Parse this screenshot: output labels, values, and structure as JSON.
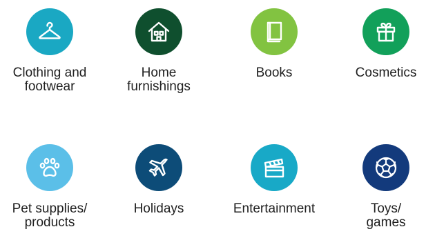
{
  "categories": [
    {
      "icon": "hanger-icon",
      "color": "#1aa8c3",
      "label_line1": "Clothing and",
      "label_line2": "footwear"
    },
    {
      "icon": "house-icon",
      "color": "#0f4f2e",
      "label_line1": "Home",
      "label_line2": "furnishings"
    },
    {
      "icon": "book-icon",
      "color": "#82c341",
      "label_line1": "Books",
      "label_line2": ""
    },
    {
      "icon": "gift-icon",
      "color": "#12a05a",
      "label_line1": "Cosmetics",
      "label_line2": ""
    },
    {
      "icon": "paw-icon",
      "color": "#5bbfe8",
      "label_line1": "Pet supplies/",
      "label_line2": "products"
    },
    {
      "icon": "airplane-icon",
      "color": "#0d4c78",
      "label_line1": "Holidays",
      "label_line2": ""
    },
    {
      "icon": "clapperboard-icon",
      "color": "#18a9c7",
      "label_line1": "Entertainment",
      "label_line2": ""
    },
    {
      "icon": "soccer-ball-icon",
      "color": "#133a7c",
      "label_line1": "Toys/",
      "label_line2": "games"
    }
  ]
}
